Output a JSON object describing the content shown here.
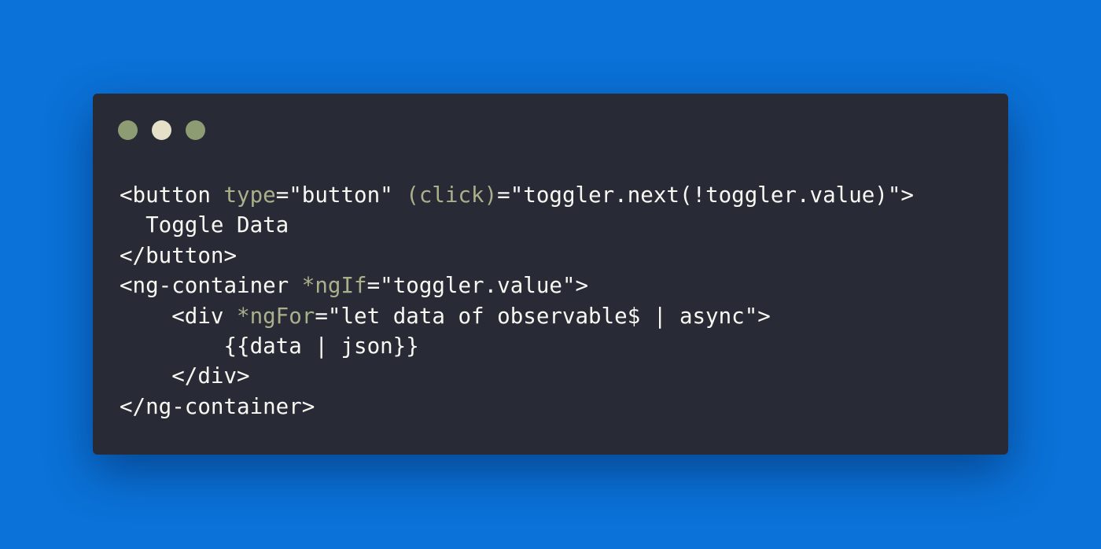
{
  "window": {
    "dots": [
      {
        "name": "dot-1",
        "color": "#8e9c73"
      },
      {
        "name": "dot-2",
        "color": "#e6e0c8"
      },
      {
        "name": "dot-3",
        "color": "#8e9c73"
      }
    ]
  },
  "code": {
    "lines": [
      [
        {
          "t": "<button ",
          "c": "plain"
        },
        {
          "t": "type",
          "c": "attr"
        },
        {
          "t": "=\"button\" ",
          "c": "plain"
        },
        {
          "t": "(click)",
          "c": "attr"
        },
        {
          "t": "=\"toggler.next(!toggler.value)\">",
          "c": "plain"
        }
      ],
      [
        {
          "t": "  Toggle Data",
          "c": "plain"
        }
      ],
      [
        {
          "t": "</button>",
          "c": "plain"
        }
      ],
      [
        {
          "t": "<ng-container ",
          "c": "plain"
        },
        {
          "t": "*ngIf",
          "c": "attr"
        },
        {
          "t": "=\"toggler.value\">",
          "c": "plain"
        }
      ],
      [
        {
          "t": "    <div ",
          "c": "plain"
        },
        {
          "t": "*ngFor",
          "c": "attr"
        },
        {
          "t": "=\"let data of observable$ | async\">",
          "c": "plain"
        }
      ],
      [
        {
          "t": "        {{data | json}}",
          "c": "plain"
        }
      ],
      [
        {
          "t": "    </div>",
          "c": "plain"
        }
      ],
      [
        {
          "t": "</ng-container>",
          "c": "plain"
        }
      ]
    ]
  }
}
